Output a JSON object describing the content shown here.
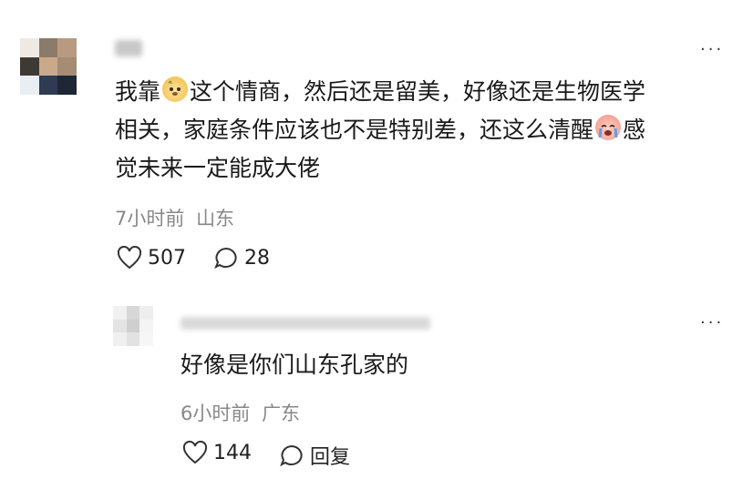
{
  "comment": {
    "text_line1_a": "我靠",
    "text_line1_b": "这个情商，然后还是留美，好像还是生物医学",
    "text_line2_a": "相关，家庭条件应该也不是特别差，还这么清醒",
    "text_line2_b": "感",
    "text_line3": "觉未来一定能成大佬",
    "time": "7小时前",
    "location": "山东",
    "likes": "507",
    "replies": "28",
    "emoji1": "dog-face-emoji",
    "emoji2": "crying-face-emoji"
  },
  "reply": {
    "text": "好像是你们山东孔家的",
    "time": "6小时前",
    "location": "广东",
    "likes": "144",
    "reply_label": "回复"
  },
  "more_glyph": "···",
  "colors": {
    "text": "#1a1a1a",
    "meta": "#888888",
    "background": "#ffffff"
  }
}
